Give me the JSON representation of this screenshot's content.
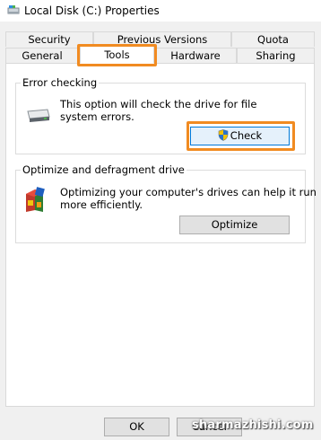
{
  "window": {
    "title": "Local Disk (C:) Properties",
    "icon": "drive-icon"
  },
  "tabs": {
    "row1": [
      "Security",
      "Previous Versions",
      "Quota"
    ],
    "row2": [
      "General",
      "Tools",
      "Hardware",
      "Sharing"
    ],
    "active": "Tools"
  },
  "error_checking": {
    "title": "Error checking",
    "description_line1": "This option will check the drive for file",
    "description_line2": "system errors.",
    "button_label": "Check"
  },
  "optimize": {
    "title": "Optimize and defragment drive",
    "description_line1": "Optimizing your computer's drives can help it run",
    "description_line2": "more efficiently.",
    "button_label": "Optimize"
  },
  "footer": {
    "ok_label": "OK",
    "cancel_label": "Cancel"
  },
  "watermark": "sharmazhishi.com",
  "colors": {
    "highlight": "#f18b21",
    "panel": "#ffffff",
    "dialog": "#f0f0f0"
  }
}
